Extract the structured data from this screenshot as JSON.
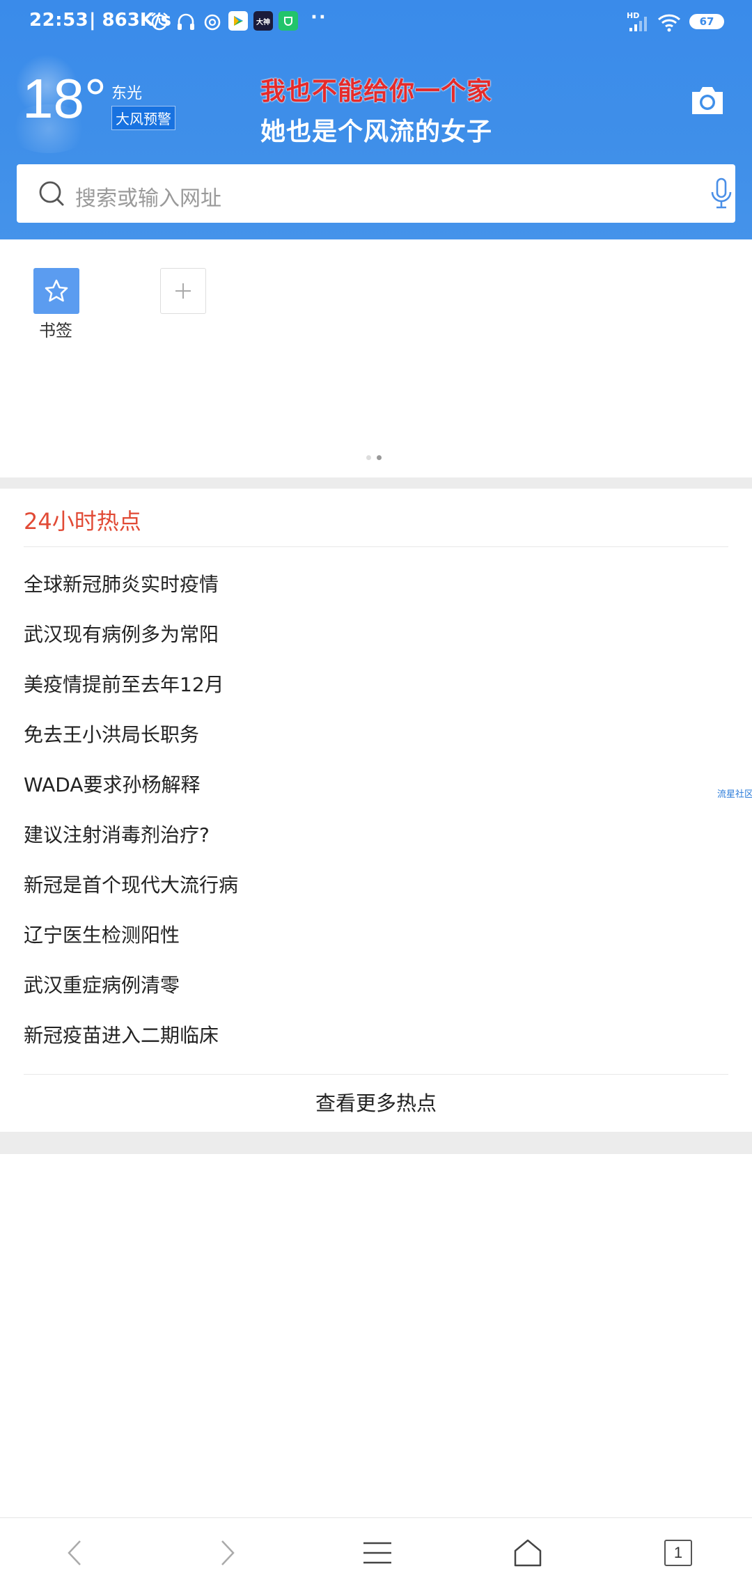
{
  "status_bar": {
    "time": "22:53",
    "speed": "| 863K/s",
    "app_badge": "大神",
    "network": "HD",
    "battery": "67"
  },
  "weather": {
    "temperature": "18°",
    "city": "东光",
    "alert": "大风预警"
  },
  "lyrics": {
    "line1": "我也不能给你一个家",
    "line2": "她也是个风流的女子"
  },
  "search": {
    "placeholder": "搜索或输入网址"
  },
  "bookmarks": {
    "label": "书签"
  },
  "hot": {
    "title": "24小时热点",
    "items": [
      "全球新冠肺炎实时疫情",
      "武汉现有病例多为常阳",
      "美疫情提前至去年12月",
      "免去王小洪局长职务",
      "WADA要求孙杨解释",
      "建议注射消毒剂治疗?",
      "新冠是首个现代大流行病",
      "辽宁医生检测阳性",
      "武汉重症病例清零",
      "新冠疫苗进入二期临床"
    ],
    "more": "查看更多热点",
    "side_tag": "流星社区"
  },
  "toolbar": {
    "tab_count": "1"
  },
  "colors": {
    "header": "#3a8bea",
    "hot_title": "#e14a35",
    "lyric_red": "#e52b2b",
    "bookmark": "#5b9cf0"
  }
}
